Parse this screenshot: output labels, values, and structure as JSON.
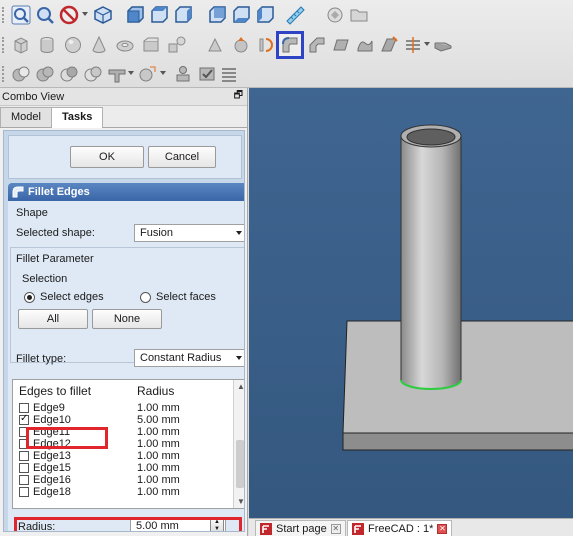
{
  "combo_view": {
    "title": "Combo View",
    "tabs": [
      {
        "label": "Model"
      },
      {
        "label": "Tasks"
      }
    ]
  },
  "dialog": {
    "ok_label": "OK",
    "cancel_label": "Cancel"
  },
  "fillet": {
    "header": "Fillet Edges",
    "shape_group": "Shape",
    "selected_shape_label": "Selected shape:",
    "selected_shape_value": "Fusion",
    "param_group": "Fillet Parameter",
    "selection_group": "Selection",
    "select_edges_label": "Select edges",
    "select_faces_label": "Select faces",
    "all_label": "All",
    "none_label": "None",
    "fillet_type_label": "Fillet type:",
    "fillet_type_value": "Constant Radius",
    "list_headers": {
      "edges": "Edges to fillet",
      "radius": "Radius"
    },
    "edges": [
      {
        "name": "Edge9",
        "radius": "1.00 mm",
        "checked": false
      },
      {
        "name": "Edge10",
        "radius": "5.00 mm",
        "checked": true
      },
      {
        "name": "Edge11",
        "radius": "1.00 mm",
        "checked": false
      },
      {
        "name": "Edge12",
        "radius": "1.00 mm",
        "checked": false
      },
      {
        "name": "Edge13",
        "radius": "1.00 mm",
        "checked": false
      },
      {
        "name": "Edge15",
        "radius": "1.00 mm",
        "checked": false
      },
      {
        "name": "Edge16",
        "radius": "1.00 mm",
        "checked": false
      },
      {
        "name": "Edge18",
        "radius": "1.00 mm",
        "checked": false
      }
    ],
    "radius_label": "Radius:",
    "radius_value": "5.00 mm"
  },
  "doc_tabs": [
    {
      "label": "Start page"
    },
    {
      "label": "FreeCAD : 1*"
    }
  ],
  "colors": {
    "accent": "#2e44c4",
    "highlight": "#e0262c",
    "viewport_bg": "#3b5f8a",
    "edge_highlight": "#2ecc40"
  }
}
